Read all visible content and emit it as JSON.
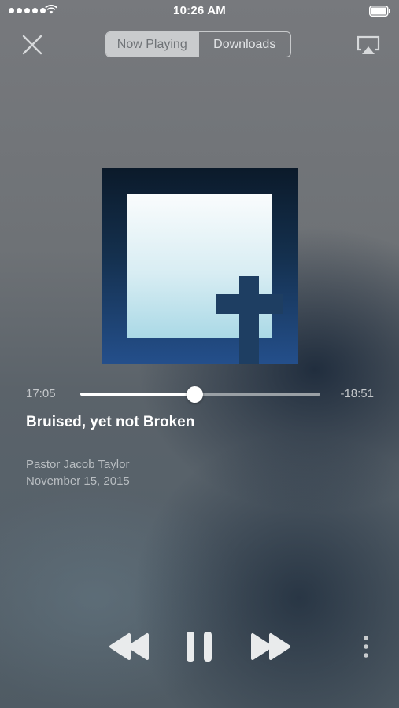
{
  "status_bar": {
    "time": "10:26 AM",
    "signal_bars": 5
  },
  "nav": {
    "tabs": [
      {
        "label": "Now Playing",
        "active": true
      },
      {
        "label": "Downloads",
        "active": false
      }
    ]
  },
  "player": {
    "elapsed": "17:05",
    "remaining": "-18:51",
    "progress": 0.475,
    "title": "Bruised, yet not Broken",
    "speaker": "Pastor Jacob Taylor",
    "date": "November 15, 2015"
  },
  "icons": {
    "close": "close-icon",
    "airplay": "airplay-icon",
    "rewind": "rewind-icon",
    "pause": "pause-icon",
    "fast_forward": "fast-forward-icon",
    "more": "more-vertical-icon"
  },
  "colors": {
    "accent": "#ffffff",
    "artwork_dark": "#0b1a2a",
    "artwork_blue": "#244f8b",
    "cross": "#1e3e62"
  }
}
